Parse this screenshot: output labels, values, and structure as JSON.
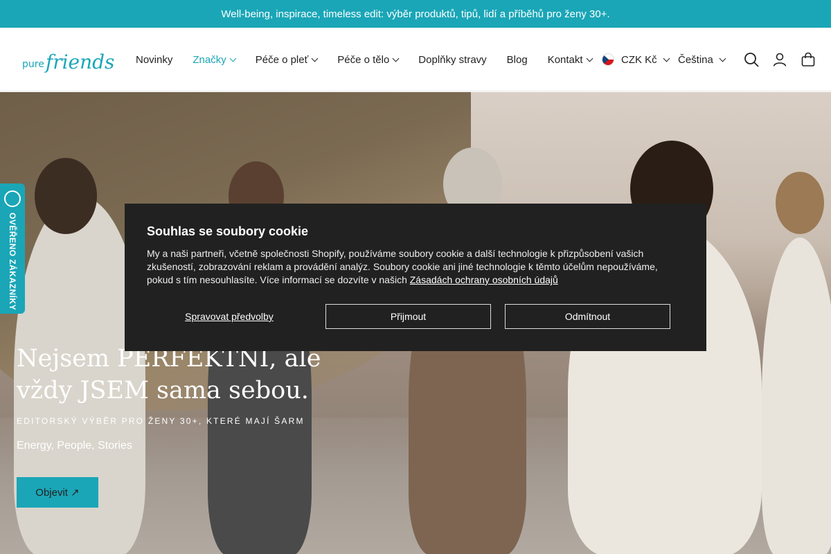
{
  "announcement": "Well-being, inspirace, timeless edit: výběr produktů, tipů, lidí a příběhů pro ženy 30+.",
  "logo": {
    "pure": "pure",
    "friends": "friends"
  },
  "nav": {
    "items": [
      {
        "label": "Novinky",
        "has_dropdown": false,
        "active": false
      },
      {
        "label": "Značky",
        "has_dropdown": true,
        "active": true
      },
      {
        "label": "Péče o pleť",
        "has_dropdown": true,
        "active": false
      },
      {
        "label": "Péče o tělo",
        "has_dropdown": true,
        "active": false
      },
      {
        "label": "Doplňky stravy",
        "has_dropdown": false,
        "active": false
      },
      {
        "label": "Blog",
        "has_dropdown": false,
        "active": false
      },
      {
        "label": "Kontakt",
        "has_dropdown": true,
        "active": false
      }
    ]
  },
  "locale": {
    "currency": "CZK Kč",
    "language": "Čeština"
  },
  "header_icons": [
    "search-icon",
    "account-icon",
    "cart-icon"
  ],
  "hero": {
    "title": "Nejsem PERFEKTNÍ, ale vždy JSEM sama sebou.",
    "subtitle": "EDITORSKÝ VÝBĚR PRO ŽENY 30+, KTERÉ MAJÍ ŠARM",
    "tagline": "Energy, People, Stories",
    "button": "Objevit ↗"
  },
  "verified_badge": "OVĚŘENO ZÁKAZNÍKY",
  "cookie": {
    "title": "Souhlas se soubory cookie",
    "body": "My a naši partneři, včetně společnosti Shopify, používáme soubory cookie a další technologie k přizpůsobení vašich zkušeností, zobrazování reklam a provádění analýz. Soubory cookie ani jiné technologie k těmto účelům nepoužíváme, pokud s tím nesouhlasíte. Více informací se dozvíte v našich",
    "link": "Zásadách ochrany osobních údajů",
    "manage": "Spravovat předvolby",
    "accept": "Přijmout",
    "decline": "Odmítnout"
  },
  "colors": {
    "accent": "#1aa6b7",
    "dialog": "#212121"
  }
}
